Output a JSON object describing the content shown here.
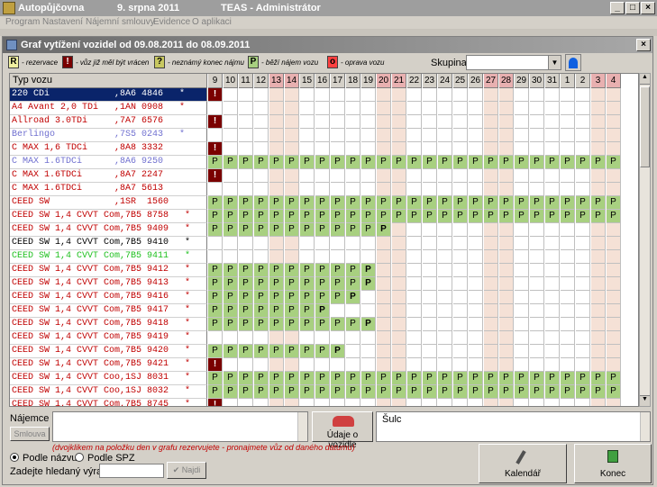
{
  "app": {
    "title": "Autopůjčovna",
    "date": "9. srpna 2011",
    "product": "TEAS - Administrátor"
  },
  "menu": [
    "Program",
    "Nastavení",
    "Nájemní smlouvy",
    "Evidence",
    "O aplikaci"
  ],
  "dialog": {
    "title": "Graf vytížení vozidel od 09.08.2011 do 08.09.2011",
    "close": "×"
  },
  "legend": [
    {
      "code": "R",
      "text": "- rezervace",
      "color": "#f0f0a0"
    },
    {
      "code": "!",
      "text": "- vůz již měl být vrácen",
      "color": "#7a0000"
    },
    {
      "code": "?",
      "text": "- neznámý konec nájmu",
      "color": "#c8c860"
    },
    {
      "code": "P",
      "text": "- běží nájem vozu",
      "color": "#a8d080"
    },
    {
      "code": "o",
      "text": "- oprava vozu",
      "color": "#ff4040"
    }
  ],
  "group": {
    "label": "Skupina:",
    "value": ""
  },
  "grid": {
    "name_header": "Typ vozu",
    "days": [
      "9",
      "10",
      "11",
      "12",
      "13",
      "14",
      "15",
      "16",
      "17",
      "18",
      "19",
      "20",
      "21",
      "22",
      "23",
      "24",
      "25",
      "26",
      "27",
      "28",
      "29",
      "30",
      "31",
      "1",
      "2",
      "3",
      "4"
    ],
    "weekend_idx": [
      4,
      5,
      11,
      12,
      18,
      19,
      25,
      26
    ],
    "rows": [
      {
        "name": "220 CDi            ,8A6 4846   *",
        "color": "#ffffff",
        "selected": true,
        "p": [],
        "x": [
          0
        ]
      },
      {
        "name": "A4 Avant 2,0 TDi   ,1AN 0908   *",
        "color": "#c00000",
        "p": [],
        "x": []
      },
      {
        "name": "Allroad 3.0TDi     ,7A7 6576",
        "color": "#c00000",
        "p": [],
        "x": [
          0
        ]
      },
      {
        "name": "Berlingo           ,7S5 0243   *",
        "color": "#7070d0",
        "p": [],
        "x": []
      },
      {
        "name": "C MAX 1,6 TDCi     ,8A8 3332",
        "color": "#c00000",
        "p": [],
        "x": [
          0
        ]
      },
      {
        "name": "C MAX 1.6TDCi      ,8A6 9250",
        "color": "#7070d0",
        "p": [
          0,
          26
        ],
        "x": []
      },
      {
        "name": "C MAX 1.6TDCi      ,8A7 2247",
        "color": "#c00000",
        "p": [],
        "x": [
          0
        ]
      },
      {
        "name": "C MAX 1.6TDCi      ,8A7 5613",
        "color": "#c00000",
        "p": [],
        "x": []
      },
      {
        "name": "CEED SW            ,1SR  1560",
        "color": "#c00000",
        "p": [
          0,
          26
        ],
        "x": []
      },
      {
        "name": "CEED SW 1,4 CVVT Com,7B5 8758   *",
        "color": "#c00000",
        "p": [
          0,
          26
        ],
        "x": []
      },
      {
        "name": "CEED SW 1,4 CVVT Com,7B5 9409   *",
        "color": "#c00000",
        "p": [
          0,
          11
        ],
        "b": 11,
        "x": []
      },
      {
        "name": "CEED SW 1,4 CVVT Com,7B5 9410   *",
        "color": "#000000",
        "p": [],
        "x": []
      },
      {
        "name": "CEED SW 1,4 CVVT Com,7B5 9411   *",
        "color": "#20c020",
        "p": [],
        "x": []
      },
      {
        "name": "CEED SW 1,4 CVVT Com,7B5 9412   *",
        "color": "#c00000",
        "p": [
          0,
          10
        ],
        "b": 10,
        "x": []
      },
      {
        "name": "CEED SW 1,4 CVVT Com,7B5 9413   *",
        "color": "#c00000",
        "p": [
          0,
          10
        ],
        "b": 10,
        "x": []
      },
      {
        "name": "CEED SW 1,4 CVVT Com,7B5 9416   *",
        "color": "#c00000",
        "p": [
          0,
          9
        ],
        "b": 9,
        "x": []
      },
      {
        "name": "CEED SW 1,4 CVVT Com,7B5 9417   *",
        "color": "#c00000",
        "p": [
          0,
          7
        ],
        "b": 7,
        "x": []
      },
      {
        "name": "CEED SW 1,4 CVVT Com,7B5 9418   *",
        "color": "#c00000",
        "p": [
          0,
          10
        ],
        "b": 10,
        "x": []
      },
      {
        "name": "CEED SW 1,4 CVVT Com,7B5 9419   *",
        "color": "#c00000",
        "p": [],
        "x": []
      },
      {
        "name": "CEED SW 1,4 CVVT Com,7B5 9420   *",
        "color": "#c00000",
        "p": [
          0,
          8
        ],
        "b": 8,
        "x": []
      },
      {
        "name": "CEED SW 1,4 CVVT Com,7B5 9421   *",
        "color": "#c00000",
        "p": [],
        "x": [
          0
        ]
      },
      {
        "name": "CEED SW 1,4 CVVT Coo,1SJ 8031   *",
        "color": "#c00000",
        "p": [
          0,
          26
        ],
        "x": []
      },
      {
        "name": "CEED SW 1,4 CVVT Coo,1SJ 8032   *",
        "color": "#c00000",
        "p": [
          0,
          26
        ],
        "x": []
      },
      {
        "name": "CEED SW 1,4 CVVT Com,7B5 8745   *",
        "color": "#c00000",
        "p": [],
        "x": [
          0
        ]
      }
    ]
  },
  "najemce_label": "Nájemce",
  "smlouva_label": "Smlouva",
  "udaje_label": "Údaje o vozidle",
  "hint": "(dvojklikem na položku den v grafu rezervujete - pronajmete vůz od daného datumu)",
  "detail_text": "Šulc",
  "radio_name": "Podle názvu",
  "radio_spz": "Podle SPZ",
  "search_label": "Zadejte hledaný výraz:",
  "search_value": "",
  "najdi_label": "Najdi",
  "kalendar_label": "Kalendář",
  "konec_label": "Konec"
}
